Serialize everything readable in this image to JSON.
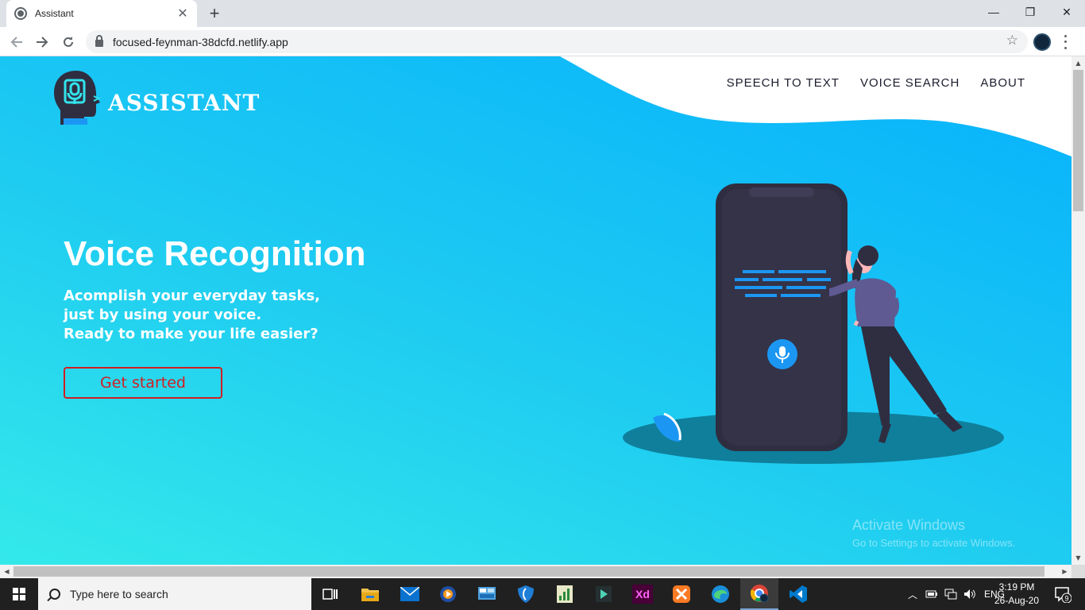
{
  "browser": {
    "tab_title": "Assistant",
    "new_tab_symbol": "+",
    "tab_close_symbol": "✕",
    "url": "focused-feynman-38dcfd.netlify.app",
    "window_controls": {
      "minimize": "—",
      "restore": "❐",
      "close": "✕"
    }
  },
  "site": {
    "brand": "Assistant",
    "nav": [
      "SPEECH TO TEXT",
      "VOICE SEARCH",
      "ABOUT"
    ],
    "hero": {
      "title": "Voice Recognition",
      "subtitle_lines": [
        "Acomplish your everyday tasks,",
        "just by using your voice.",
        "Ready to make your life easier?"
      ],
      "cta": "Get started"
    },
    "colors": {
      "gradient_start": "#34e9ea",
      "gradient_end": "#06b1fc",
      "cta": "#d11e22",
      "phone": "#2f2e41",
      "accent": "#1b97f3"
    }
  },
  "watermark": {
    "title": "Activate Windows",
    "subtitle": "Go to Settings to activate Windows."
  },
  "taskbar": {
    "search_placeholder": "Type here to search",
    "apps": [
      "task-view",
      "file-explorer",
      "mail",
      "media-player",
      "control-panel",
      "defender",
      "spreadsheet",
      "filmora",
      "adobe-xd",
      "xampp",
      "edge",
      "chrome",
      "vscode"
    ],
    "tray": {
      "language": "ENG",
      "time": "3:19 PM",
      "date": "26-Aug-20",
      "notification_count": "9"
    }
  }
}
